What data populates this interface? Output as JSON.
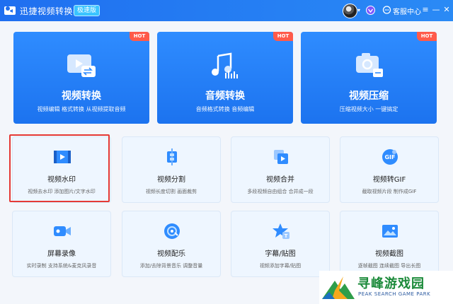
{
  "app": {
    "title": "迅捷视频转换器",
    "edition_badge": "极速版",
    "service_label": "客服中心",
    "window_controls": {
      "menu": "≡",
      "minimize": "—",
      "close": "✕"
    }
  },
  "colors": {
    "titlebar": "#1f6ff0",
    "hero_bg": "#2f8cff",
    "hot": "#ff5a4a",
    "card_bg": "#eef6ff",
    "selected_outline": "#e53935"
  },
  "hot_label": "HOT",
  "hero_cards": [
    {
      "title": "视频转换",
      "desc": "视频编辑 格式转换 从视频提取音频",
      "icon": "video-convert-icon"
    },
    {
      "title": "音频转换",
      "desc": "音频格式转换 音频编辑",
      "icon": "audio-convert-icon"
    },
    {
      "title": "视频压缩",
      "desc": "压缩视频大小 一键搞定",
      "icon": "video-compress-icon"
    }
  ],
  "tool_cards": [
    {
      "title": "视频水印",
      "desc": "视频去水印 添加图片/文字水印",
      "icon": "video-watermark-icon"
    },
    {
      "title": "视频分割",
      "desc": "视频长度切割 画面裁剪",
      "icon": "video-split-icon"
    },
    {
      "title": "视频合并",
      "desc": "多段视频自由组合 合并成一段",
      "icon": "video-merge-icon"
    },
    {
      "title": "视频转GIF",
      "desc": "截取视频片段 制作成GIF",
      "icon": "video-to-gif-icon"
    },
    {
      "title": "屏幕录像",
      "desc": "实时录制 支持系统&麦克风录音",
      "icon": "screen-record-icon"
    },
    {
      "title": "视频配乐",
      "desc": "添加/去除背景音乐 调整音量",
      "icon": "video-music-icon"
    },
    {
      "title": "字幕/贴图",
      "desc": "视频添加字幕/贴图",
      "icon": "subtitle-sticker-icon"
    },
    {
      "title": "视频截图",
      "desc": "逐帧截图 连续截图 导出长图",
      "icon": "video-screenshot-icon"
    }
  ],
  "gif_label": "GIF",
  "watermark": {
    "title": "寻峰游戏园",
    "subtitle": "PEAK SEARCH GAME PARK"
  }
}
